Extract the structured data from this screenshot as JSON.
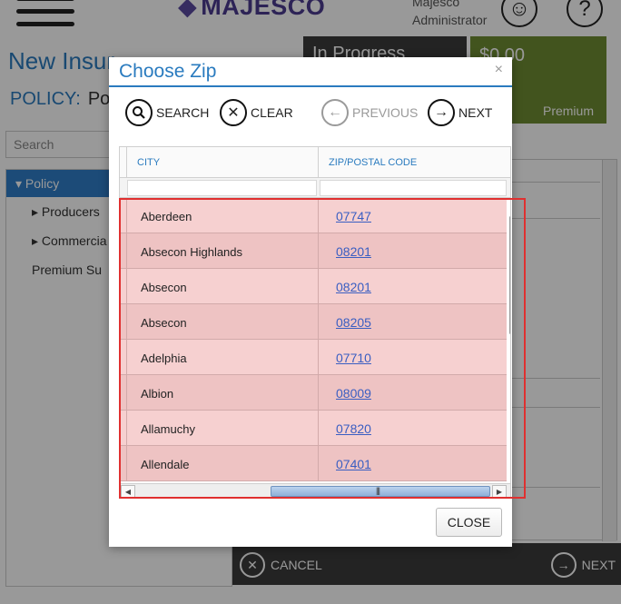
{
  "app": {
    "logo_text": "MAJESCO",
    "user_line1": "Majesco",
    "user_line2": "Administrator",
    "page_title": "New Insur",
    "policy_label": "POLICY:",
    "policy_value": "Pol",
    "status": "In Progress",
    "premium_amount": "$0.00",
    "premium_label": "Premium",
    "search_placeholder": "Search",
    "tree": {
      "selected": "Policy",
      "items": [
        "Producers",
        "Commercia",
        "Premium Su"
      ]
    },
    "bottom": {
      "cancel_label": "CANCEL",
      "next_label": "NEXT"
    }
  },
  "modal": {
    "title": "Choose Zip",
    "close_glyph": "×",
    "toolbar": {
      "search_label": "SEARCH",
      "clear_label": "CLEAR",
      "previous_label": "PREVIOUS",
      "next_label": "NEXT"
    },
    "columns": {
      "city": "CITY",
      "zip": "ZIP/POSTAL CODE"
    },
    "rows": [
      {
        "city": "Aberdeen",
        "zip": "07747"
      },
      {
        "city": "Absecon Highlands",
        "zip": "08201"
      },
      {
        "city": "Absecon",
        "zip": "08201"
      },
      {
        "city": "Absecon",
        "zip": "08205"
      },
      {
        "city": "Adelphia",
        "zip": "07710"
      },
      {
        "city": "Albion",
        "zip": "08009"
      },
      {
        "city": "Allamuchy",
        "zip": "07820"
      },
      {
        "city": "Allendale",
        "zip": "07401"
      }
    ],
    "close_button": "CLOSE"
  },
  "colors": {
    "accent": "#2a7bbf",
    "highlight_border": "#e03030",
    "row_tint": "#f6d0d0",
    "status_bg": "#3b3b3b",
    "premium_bg": "#6f8c32"
  }
}
